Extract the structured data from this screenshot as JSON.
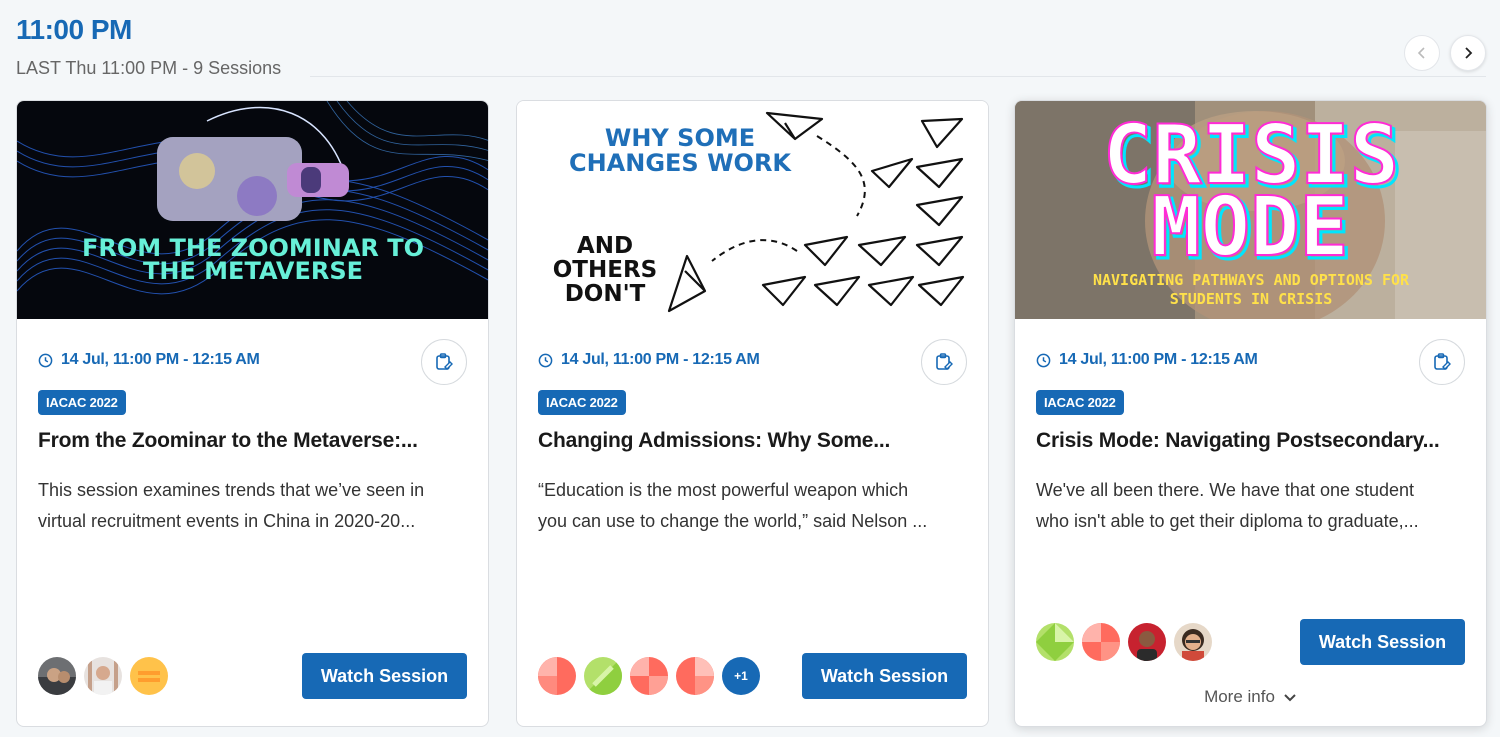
{
  "header": {
    "slot_time": "11:00 PM",
    "slot_subtitle": "LAST Thu 11:00 PM - 9  Sessions"
  },
  "nav": {
    "prev_icon": "chevron-left-icon",
    "next_icon": "chevron-right-icon"
  },
  "cards": [
    {
      "thumb_lines": [
        "FROM THE ZOOMINAR TO",
        "THE METAVERSE"
      ],
      "time": "14 Jul, 11:00 PM - 12:15 AM",
      "tag": "IACAC 2022",
      "title": "From the Zoominar to the Metaverse:...",
      "desc_lines": [
        "This session examines trends that we’ve seen in",
        "virtual recruitment events in China in 2020-20..."
      ],
      "button": "Watch Session"
    },
    {
      "thumb_lines": [
        "WHY SOME",
        "CHANGES WORK",
        "AND",
        "OTHERS",
        "DON'T"
      ],
      "time": "14 Jul, 11:00 PM - 12:15 AM",
      "tag": "IACAC 2022",
      "title": "Changing Admissions: Why Some...",
      "desc_lines": [
        "“Education is the most powerful weapon which",
        "you can use to change the world,” said Nelson ..."
      ],
      "extra_speakers": "+1",
      "button": "Watch Session"
    },
    {
      "thumb_lines": [
        "CRISIS",
        "MODE",
        "NAVIGATING PATHWAYS AND OPTIONS FOR",
        "STUDENTS IN CRISIS"
      ],
      "time": "14 Jul, 11:00 PM - 12:15 AM",
      "tag": "IACAC 2022",
      "title": "Crisis Mode: Navigating Postsecondary...",
      "desc_lines": [
        "We've all been there. We have that one student",
        "who isn't able to get their diploma to graduate,..."
      ],
      "button": "Watch Session",
      "more_info": "More info"
    }
  ],
  "colors": {
    "accent": "#1769b5",
    "page_bg": "#f4f7f9"
  }
}
